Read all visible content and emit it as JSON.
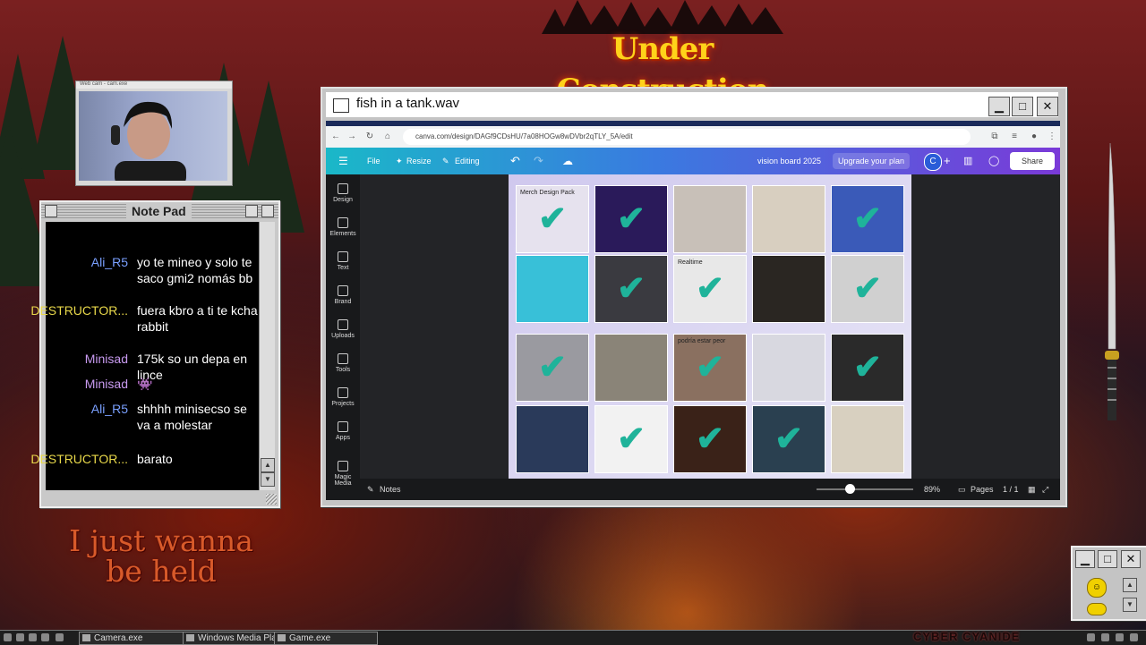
{
  "header": {
    "banner": "Under Construction"
  },
  "webcam": {
    "title": "Web cam - cam.exe"
  },
  "notepad": {
    "title": "Note Pad",
    "messages": [
      {
        "user": "Ali_R5",
        "user_color": "#7aa0ff",
        "text": "yo te mineo y solo te saco gmi2 nomás bb"
      },
      {
        "user": "DESTRUCTOR...",
        "user_color": "#e8d84a",
        "text": "fuera kbro a ti te kcha rabbit"
      },
      {
        "user": "Minisad",
        "user_color": "#c89af0",
        "text": "175k so un depa en lince"
      },
      {
        "user": "Minisad",
        "user_color": "#c89af0",
        "text": "👾"
      },
      {
        "user": "Ali_R5",
        "user_color": "#7aa0ff",
        "text": "shhhh minisecso se va a molestar"
      },
      {
        "user": "DESTRUCTOR...",
        "user_color": "#e8d84a",
        "text": "barato"
      }
    ]
  },
  "overlay_text": "I just wanna be held",
  "window": {
    "title": "fish in a tank.wav",
    "minimize": "▁",
    "maximize": "□",
    "close": "✕"
  },
  "browser": {
    "url": "canva.com/design/DAGf9CDsHU/7a08HOGw8wDVbr2qTLY_5A/edit"
  },
  "canva": {
    "menu": [
      "File",
      "Resize",
      "Editing"
    ],
    "design_name": "vision board 2025",
    "upgrade": "Upgrade your plan",
    "avatar": "C",
    "share": "Share",
    "sidebar": [
      "Design",
      "Elements",
      "Text",
      "Brand",
      "Uploads",
      "Tools",
      "Projects",
      "Apps",
      "Magic Media"
    ],
    "tiles": [
      {
        "label": "Merch Design Pack",
        "checked": true,
        "color": "#e6e2ee"
      },
      {
        "label": "",
        "checked": true,
        "color": "#2a1a5a"
      },
      {
        "label": "",
        "checked": false,
        "color": "#c8c0b8"
      },
      {
        "label": "",
        "checked": false,
        "color": "#d8cfc0"
      },
      {
        "label": "",
        "checked": true,
        "color": "#3a5ab8"
      },
      {
        "label": "",
        "checked": false,
        "color": "#38c0d8"
      },
      {
        "label": "",
        "checked": true,
        "color": "#3a3a40"
      },
      {
        "label": "Realtime",
        "checked": true,
        "color": "#e8e8e8"
      },
      {
        "label": "",
        "checked": false,
        "color": "#2a2622"
      },
      {
        "label": "",
        "checked": true,
        "color": "#d0d0d0"
      },
      {
        "label": "",
        "checked": true,
        "color": "#9a9aa0"
      },
      {
        "label": "",
        "checked": false,
        "color": "#8a8478"
      },
      {
        "label": "podría estar peor",
        "checked": true,
        "color": "#8a7060"
      },
      {
        "label": "",
        "checked": false,
        "color": "#d8d8e0"
      },
      {
        "label": "",
        "checked": true,
        "color": "#2a2a2a"
      },
      {
        "label": "",
        "checked": false,
        "color": "#2a3a5a"
      },
      {
        "label": "",
        "checked": true,
        "color": "#f2f2f2"
      },
      {
        "label": "",
        "checked": true,
        "color": "#3a2218"
      },
      {
        "label": "",
        "checked": true,
        "color": "#2a4050"
      },
      {
        "label": "",
        "checked": false,
        "color": "#d8d0c0"
      }
    ],
    "bottom": {
      "notes": "Notes",
      "zoom": "89%",
      "pages": "Pages",
      "page_count": "1 / 1"
    }
  },
  "widget": {
    "brand": "CYBER CYANIDE"
  },
  "taskbar": {
    "items": [
      "Camera.exe",
      "Windows Media Pla",
      "Game.exe"
    ]
  }
}
